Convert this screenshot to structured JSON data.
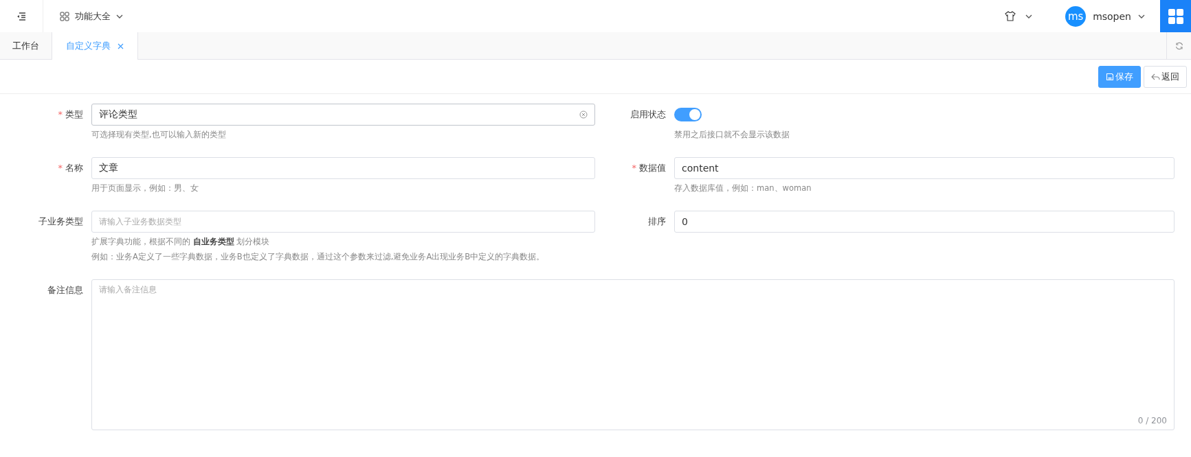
{
  "header": {
    "nav_label": "功能大全",
    "user": {
      "avatar": "ms",
      "name": "msopen"
    }
  },
  "tabs": [
    {
      "label": "工作台",
      "selected": false,
      "closable": false
    },
    {
      "label": "自定义字典",
      "selected": true,
      "closable": true
    }
  ],
  "toolbar": {
    "buttons": [
      {
        "label": "保存",
        "kind": "primary"
      },
      {
        "label": "返回",
        "kind": "default"
      }
    ]
  },
  "form": {
    "fields": [
      {
        "kind": "select",
        "label": "类型",
        "required_mark": "*",
        "value": "评论类型",
        "hints": [
          "可选择现有类型,也可以输入新的类型"
        ]
      },
      {
        "kind": "switch",
        "label": "启用状态",
        "on": true,
        "hints": [
          "禁用之后接口就不会显示该数据"
        ]
      },
      {
        "kind": "input",
        "label": "名称",
        "required_mark": "*",
        "value": "文章",
        "hints": [
          "用于页面显示，例如：男、女"
        ]
      },
      {
        "kind": "input",
        "label": "数据值",
        "required_mark": "*",
        "value": "content",
        "hints": [
          "存入数据库值，例如：man、woman"
        ]
      },
      {
        "kind": "input",
        "label": "子业务类型",
        "placeholder": "请输入子业务数据类型",
        "hints": [
          "扩展字典功能，根据不同的 **自业务类型** 划分模块",
          "例如：业务A定义了一些字典数据，业务B也定义了字典数据，通过这个参数来过滤,避免业务A出现业务B中定义的字典数据。"
        ]
      },
      {
        "kind": "input",
        "label": "排序",
        "value": "0"
      },
      {
        "kind": "textarea",
        "label": "备注信息",
        "placeholder": "请输入备注信息",
        "counter": "0 / 200"
      }
    ]
  }
}
